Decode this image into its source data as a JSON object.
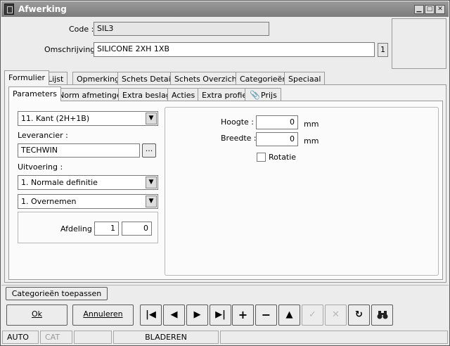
{
  "window": {
    "title": "Afwerking"
  },
  "record": {
    "code_label": "Code :",
    "code_value": "SIL3",
    "desc_label": "Omschrijving :",
    "desc_value": "SILICONE  2XH 1XB",
    "desc_badge": "1"
  },
  "main_tabs": [
    "Formulier",
    "Lijst",
    "Opmerking",
    "Schets Detail",
    "Schets Overzicht",
    "Categorieën",
    "Speciaal"
  ],
  "sub_tabs": [
    "Parameters",
    "Norm afmetingen",
    "Extra beslag",
    "Acties",
    "Extra profiel",
    "Prijs"
  ],
  "params": {
    "type_combo": "11. Kant (2H+1B)",
    "leverancier_label": "Leverancier :",
    "leverancier_value": "TECHWIN",
    "browse_button": "...",
    "uitvoering_label": "Uitvoering :",
    "uitvoering_combo": "1.  Normale definitie",
    "overnemen_combo": "1.  Overnemen",
    "afdeling_label": "Afdeling :",
    "afdeling_value1": "1",
    "afdeling_value2": "0"
  },
  "dimensions": {
    "hoogte_label": "Hoogte :",
    "hoogte_value": "0",
    "hoogte_unit": "mm",
    "breedte_label": "Breedte :",
    "breedte_value": "0",
    "breedte_unit": "mm",
    "rotatie_label": "Rotatie"
  },
  "actions": {
    "apply_categories": "Categorieën toepassen",
    "ok": "Ok",
    "cancel": "Annuleren"
  },
  "status": {
    "mode": "AUTO",
    "cat": "CAT",
    "state": "BLADEREN"
  },
  "icons": [
    "app-icon",
    "minimize-icon",
    "maximize-icon",
    "close-icon",
    "paperclip-icon",
    "first-record-icon",
    "previous-record-icon",
    "next-record-icon",
    "last-record-icon",
    "add-icon",
    "delete-icon",
    "up-icon",
    "confirm-icon",
    "discard-icon",
    "refresh-icon",
    "search-binoculars-icon"
  ]
}
